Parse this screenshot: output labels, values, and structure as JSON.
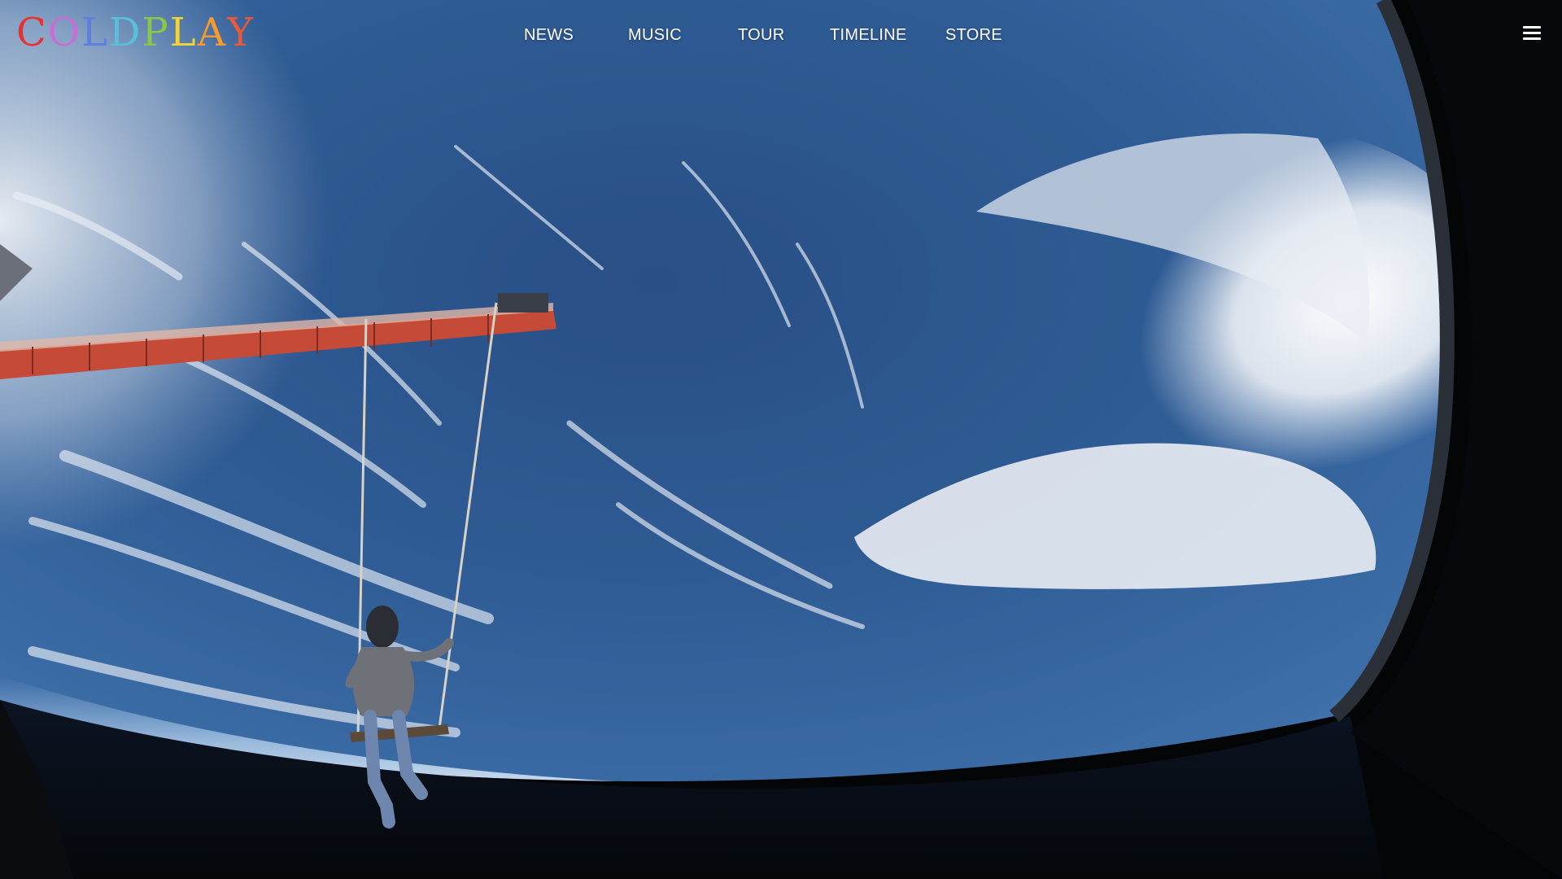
{
  "brand": {
    "logo_letters": [
      {
        "char": "C",
        "color": "#e8312f"
      },
      {
        "char": "O",
        "color": "#c56fd3"
      },
      {
        "char": "L",
        "color": "#5d7ee0"
      },
      {
        "char": "D",
        "color": "#58c0d8"
      },
      {
        "char": "P",
        "color": "#8bc64a"
      },
      {
        "char": "L",
        "color": "#f4d23a"
      },
      {
        "char": "A",
        "color": "#f59a2d"
      },
      {
        "char": "Y",
        "color": "#ec5a35"
      }
    ]
  },
  "nav": {
    "items": [
      {
        "label": "NEWS"
      },
      {
        "label": "MUSIC"
      },
      {
        "label": "TOUR"
      },
      {
        "label": "TIMELINE"
      },
      {
        "label": "STORE"
      }
    ]
  },
  "menu": {
    "icon": "hamburger-menu-icon"
  },
  "hero": {
    "colors": {
      "ocean": "#2f5c95",
      "deep_ocean": "#1c3f72",
      "cloud": "#f1f2f5",
      "frame": "#050608",
      "crane": "#d2543f"
    }
  }
}
